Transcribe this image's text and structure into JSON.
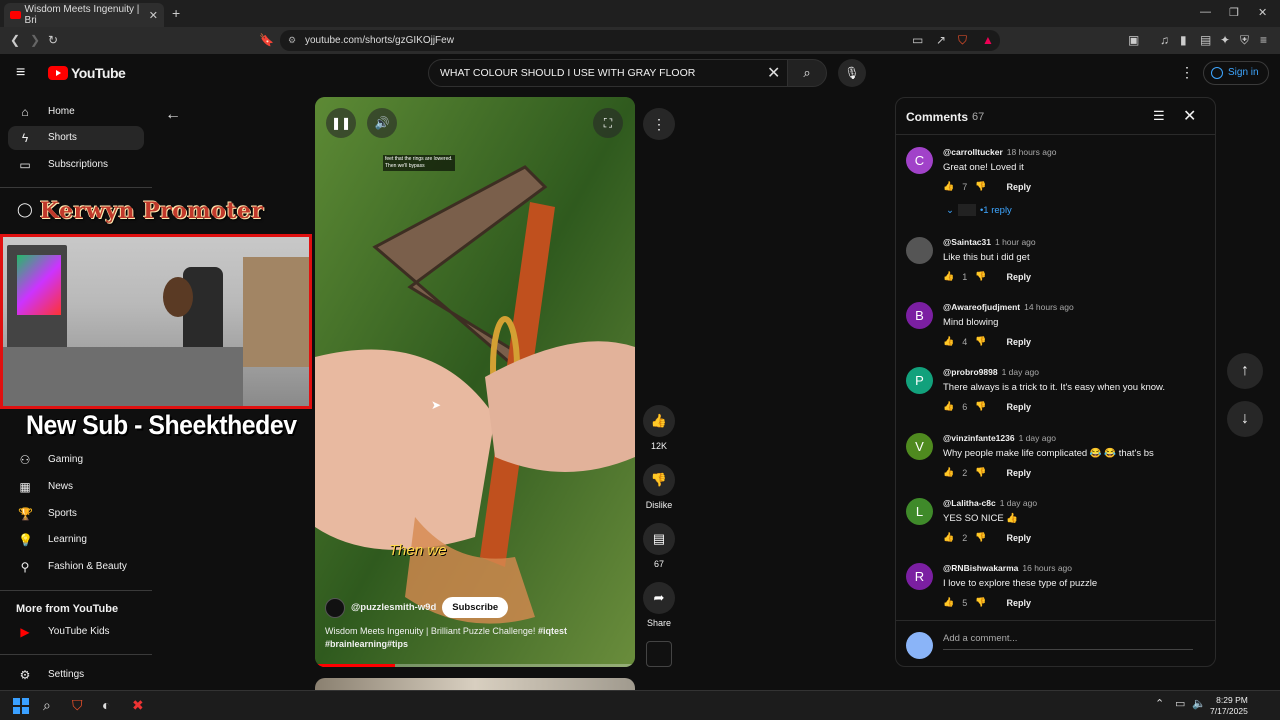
{
  "browser": {
    "tab_title": "Wisdom Meets Ingenuity | Bri",
    "url": "youtube.com/shorts/gzGIKOjjFew"
  },
  "header": {
    "logo_text": "YouTube",
    "search_value": "WHAT COLOUR SHOULD I USE WITH GRAY FLOOR",
    "sign_in": "Sign in"
  },
  "sidebar": {
    "items": [
      {
        "label": "Home",
        "icon": "home-icon"
      },
      {
        "label": "Shorts",
        "icon": "shorts-icon"
      },
      {
        "label": "Subscriptions",
        "icon": "subscriptions-icon"
      }
    ],
    "explore_items": [
      {
        "label": "Gaming",
        "icon": "gaming-icon"
      },
      {
        "label": "News",
        "icon": "news-icon"
      },
      {
        "label": "Sports",
        "icon": "sports-icon"
      },
      {
        "label": "Learning",
        "icon": "learning-icon"
      },
      {
        "label": "Fashion & Beauty",
        "icon": "fashion-icon"
      }
    ],
    "more_heading": "More from YouTube",
    "youtube_kids": "YouTube Kids",
    "settings": "Settings"
  },
  "overlay": {
    "promoter": "Kerwyn Promoter",
    "new_sub": "New Sub - Sheekthedev"
  },
  "video": {
    "caption_line1": "feet that the rings are lowered.",
    "caption_line2": "Then we'll bypass",
    "subtitle": "Then we",
    "channel": "@puzzlesmith-w9d",
    "subscribe": "Subscribe",
    "title_plain": "Wisdom Meets Ingenuity | Brilliant Puzzle Challenge! ",
    "title_tag1": "#iqtest",
    "title_tag2": "#brainlearning#tips",
    "progress": 0.25
  },
  "actions": {
    "likes": "12K",
    "dislike": "Dislike",
    "comments": "67",
    "share": "Share"
  },
  "comments": {
    "title": "Comments",
    "count": "67",
    "replies_label": "1 reply",
    "add_placeholder": "Add a comment...",
    "reply_label": "Reply",
    "items": [
      {
        "initial": "C",
        "color": "#a142c9",
        "user": "@carrolltucker",
        "time": "18 hours ago",
        "text": "Great one! Loved it",
        "likes": "7"
      },
      {
        "initial": "",
        "color": "#555555",
        "user": "@Saintac31",
        "time": "1 hour ago",
        "text": "Like this but i did get",
        "likes": "1"
      },
      {
        "initial": "B",
        "color": "#7b1fa2",
        "user": "@Awareofjudjment",
        "time": "14 hours ago",
        "text": "Mind blowing",
        "likes": "4"
      },
      {
        "initial": "P",
        "color": "#12a17c",
        "user": "@probro9898",
        "time": "1 day ago",
        "text": "There always is a trick to it. It's easy when you know.",
        "likes": "6"
      },
      {
        "initial": "V",
        "color": "#4f8a1f",
        "user": "@vinzinfante1236",
        "time": "1 day ago",
        "text": "Why people make life complicated 😂 😂 that's bs",
        "likes": "2"
      },
      {
        "initial": "L",
        "color": "#3f8a2a",
        "user": "@Lalitha-c8c",
        "time": "1 day ago",
        "text": "YES  SO  NICE  👍",
        "likes": "2"
      },
      {
        "initial": "R",
        "color": "#7b1fa2",
        "user": "@RNBishwakarma",
        "time": "16 hours ago",
        "text": "I love to explore these type of puzzle",
        "likes": "5"
      }
    ]
  },
  "taskbar": {
    "time": "8:29 PM",
    "date": "7/17/2025"
  }
}
